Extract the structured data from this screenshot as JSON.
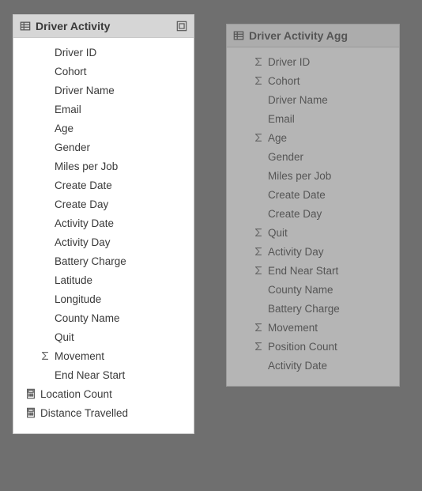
{
  "panels": [
    {
      "title": "Driver Activity",
      "dim": false,
      "headerExtra": true,
      "fields": [
        {
          "label": "Driver ID",
          "icon": null,
          "indent": true
        },
        {
          "label": "Cohort",
          "icon": null,
          "indent": true
        },
        {
          "label": "Driver Name",
          "icon": null,
          "indent": true
        },
        {
          "label": "Email",
          "icon": null,
          "indent": true
        },
        {
          "label": "Age",
          "icon": null,
          "indent": true
        },
        {
          "label": "Gender",
          "icon": null,
          "indent": true
        },
        {
          "label": "Miles per Job",
          "icon": null,
          "indent": true
        },
        {
          "label": "Create Date",
          "icon": null,
          "indent": true
        },
        {
          "label": "Create Day",
          "icon": null,
          "indent": true
        },
        {
          "label": "Activity Date",
          "icon": null,
          "indent": true
        },
        {
          "label": "Activity Day",
          "icon": null,
          "indent": true
        },
        {
          "label": "Battery Charge",
          "icon": null,
          "indent": true
        },
        {
          "label": "Latitude",
          "icon": null,
          "indent": true
        },
        {
          "label": "Longitude",
          "icon": null,
          "indent": true
        },
        {
          "label": "County Name",
          "icon": null,
          "indent": true
        },
        {
          "label": "Quit",
          "icon": null,
          "indent": true
        },
        {
          "label": "Movement",
          "icon": "sigma",
          "indent": true
        },
        {
          "label": "End Near Start",
          "icon": null,
          "indent": true
        },
        {
          "label": "Location Count",
          "icon": "calc",
          "indent": false
        },
        {
          "label": "Distance Travelled",
          "icon": "calc",
          "indent": false
        }
      ]
    },
    {
      "title": "Driver Activity Agg",
      "dim": true,
      "headerExtra": false,
      "fields": [
        {
          "label": "Driver ID",
          "icon": "sigma",
          "indent": true
        },
        {
          "label": "Cohort",
          "icon": "sigma",
          "indent": true
        },
        {
          "label": "Driver Name",
          "icon": null,
          "indent": true
        },
        {
          "label": "Email",
          "icon": null,
          "indent": true
        },
        {
          "label": "Age",
          "icon": "sigma",
          "indent": true
        },
        {
          "label": "Gender",
          "icon": null,
          "indent": true
        },
        {
          "label": "Miles per Job",
          "icon": null,
          "indent": true
        },
        {
          "label": "Create Date",
          "icon": null,
          "indent": true
        },
        {
          "label": "Create Day",
          "icon": null,
          "indent": true
        },
        {
          "label": "Quit",
          "icon": "sigma",
          "indent": true
        },
        {
          "label": "Activity Day",
          "icon": "sigma",
          "indent": true
        },
        {
          "label": "End Near Start",
          "icon": "sigma",
          "indent": true
        },
        {
          "label": "County Name",
          "icon": null,
          "indent": true
        },
        {
          "label": "Battery Charge",
          "icon": null,
          "indent": true
        },
        {
          "label": "Movement",
          "icon": "sigma",
          "indent": true
        },
        {
          "label": "Position Count",
          "icon": "sigma",
          "indent": true
        },
        {
          "label": "Activity Date",
          "icon": null,
          "indent": true
        }
      ]
    }
  ]
}
